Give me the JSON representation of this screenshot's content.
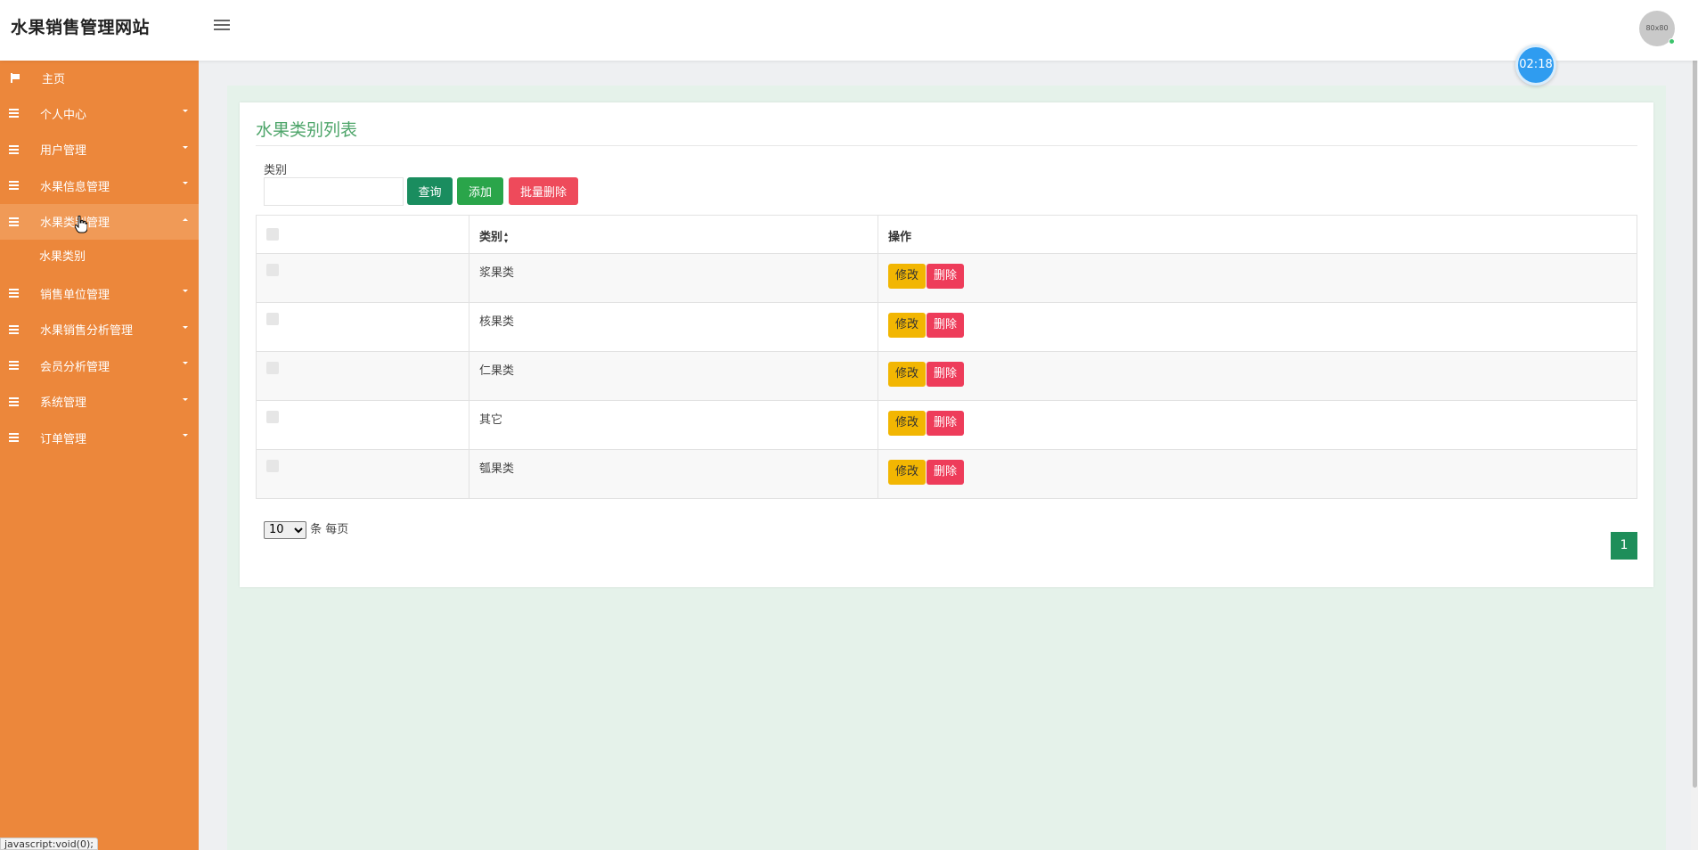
{
  "app": {
    "title": "水果销售管理网站",
    "avatar_text": "80x80",
    "timer": "02:18",
    "status_url": "javascript:void(0);"
  },
  "sidebar": {
    "items": [
      {
        "label": "主页",
        "icon": "flag-icon"
      },
      {
        "label": "个人中心",
        "icon": "list-icon"
      },
      {
        "label": "用户管理",
        "icon": "list-icon"
      },
      {
        "label": "水果信息管理",
        "icon": "list-icon"
      },
      {
        "label": "水果类别管理",
        "icon": "list-icon",
        "active": true,
        "children": [
          {
            "label": "水果类别"
          }
        ]
      },
      {
        "label": "销售单位管理",
        "icon": "list-icon"
      },
      {
        "label": "水果销售分析管理",
        "icon": "list-icon"
      },
      {
        "label": "会员分析管理",
        "icon": "list-icon"
      },
      {
        "label": "系统管理",
        "icon": "list-icon"
      },
      {
        "label": "订单管理",
        "icon": "list-icon"
      }
    ]
  },
  "page": {
    "title": "水果类别列表",
    "filter": {
      "label": "类别",
      "value": "",
      "placeholder": ""
    },
    "buttons": {
      "query": "查询",
      "add": "添加",
      "batch_delete": "批量删除"
    },
    "table": {
      "columns": [
        "",
        "类别",
        "操作"
      ],
      "rows": [
        {
          "category": "浆果类"
        },
        {
          "category": "核果类"
        },
        {
          "category": "仁果类"
        },
        {
          "category": "其它"
        },
        {
          "category": "瓠果类"
        }
      ],
      "actions": {
        "edit": "修改",
        "delete": "删除"
      }
    },
    "pagination": {
      "page_size": "10",
      "page_size_options": [
        "10"
      ],
      "per_page_suffix": "条 每页",
      "current_page": "1"
    }
  },
  "colors": {
    "sidebar": "#ec873b",
    "accent_green": "#4ea56a",
    "query_btn": "#1a8d5f",
    "add_btn": "#2aa54a",
    "danger": "#ee4a5b",
    "warning": "#f2b602"
  }
}
